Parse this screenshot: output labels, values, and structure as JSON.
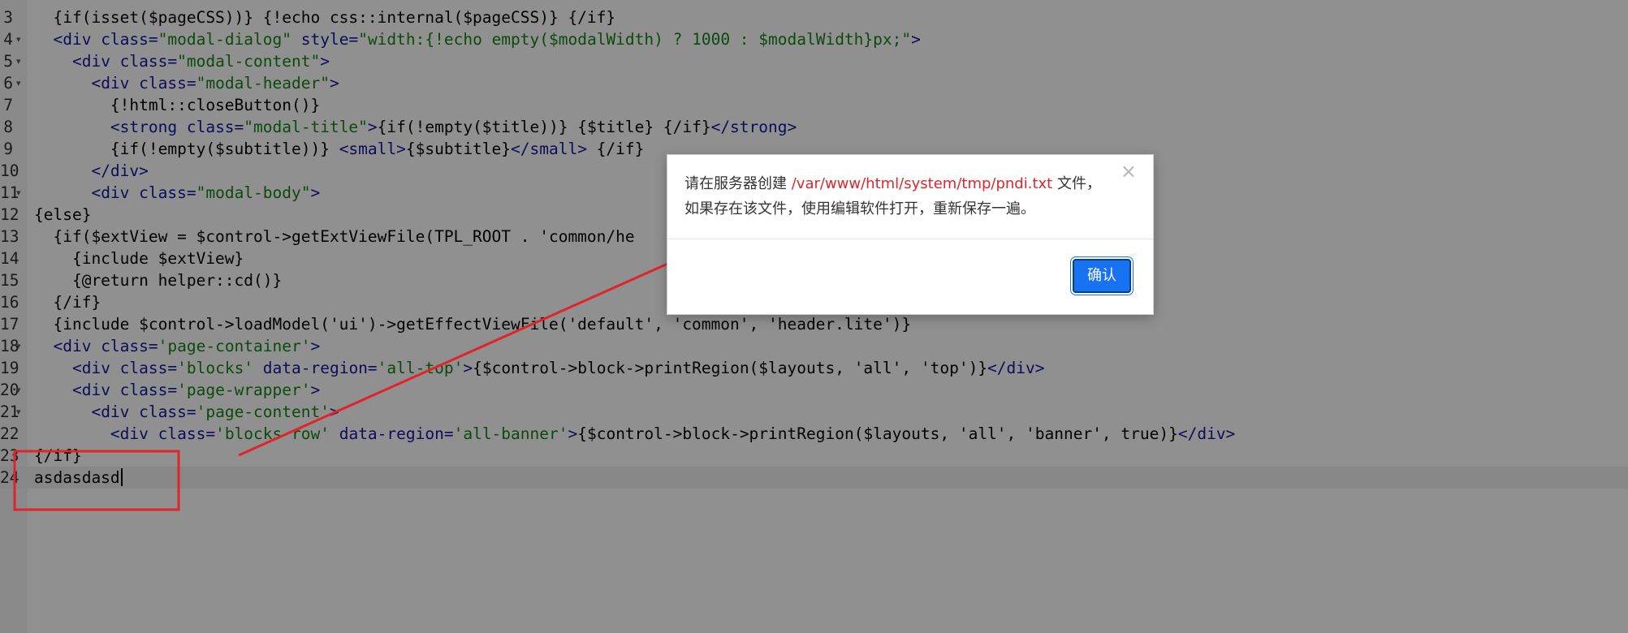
{
  "editor": {
    "lines": [
      {
        "num": "3",
        "fold": false,
        "active": false,
        "segments": [
          [
            "  {if(isset($pageCSS))} {!echo css::internal($pageCSS)} {/if}",
            "p"
          ]
        ]
      },
      {
        "num": "4",
        "fold": true,
        "active": false,
        "segments": [
          [
            "  ",
            "p"
          ],
          [
            "<div ",
            "t"
          ],
          [
            "class=",
            "t"
          ],
          [
            "\"modal-dialog\"",
            "s"
          ],
          [
            " style=",
            "t"
          ],
          [
            "\"width:{!echo empty($modalWidth) ? 1000 : $modalWidth}px;\"",
            "s"
          ],
          [
            ">",
            "t"
          ]
        ]
      },
      {
        "num": "5",
        "fold": true,
        "active": false,
        "segments": [
          [
            "    ",
            "p"
          ],
          [
            "<div ",
            "t"
          ],
          [
            "class=",
            "t"
          ],
          [
            "\"modal-content\"",
            "s"
          ],
          [
            ">",
            "t"
          ]
        ]
      },
      {
        "num": "6",
        "fold": true,
        "active": false,
        "segments": [
          [
            "      ",
            "p"
          ],
          [
            "<div ",
            "t"
          ],
          [
            "class=",
            "t"
          ],
          [
            "\"modal-header\"",
            "s"
          ],
          [
            ">",
            "t"
          ]
        ]
      },
      {
        "num": "7",
        "fold": false,
        "active": false,
        "segments": [
          [
            "        {!html::closeButton()}",
            "p"
          ]
        ]
      },
      {
        "num": "8",
        "fold": false,
        "active": false,
        "segments": [
          [
            "        ",
            "p"
          ],
          [
            "<strong ",
            "t"
          ],
          [
            "class=",
            "t"
          ],
          [
            "\"modal-title\"",
            "s"
          ],
          [
            ">",
            "t"
          ],
          [
            "{if(!empty($title))} {$title} {/if}",
            "p"
          ],
          [
            "</strong>",
            "t"
          ]
        ]
      },
      {
        "num": "9",
        "fold": false,
        "active": false,
        "segments": [
          [
            "        {if(!empty($subtitle))} ",
            "p"
          ],
          [
            "<small>",
            "t"
          ],
          [
            "{$subtitle}",
            "p"
          ],
          [
            "</small>",
            "t"
          ],
          [
            " {/if}",
            "p"
          ]
        ]
      },
      {
        "num": "10",
        "fold": false,
        "active": false,
        "segments": [
          [
            "      ",
            "p"
          ],
          [
            "</div>",
            "t"
          ]
        ]
      },
      {
        "num": "11",
        "fold": true,
        "active": false,
        "segments": [
          [
            "      ",
            "p"
          ],
          [
            "<div ",
            "t"
          ],
          [
            "class=",
            "t"
          ],
          [
            "\"modal-body\"",
            "s"
          ],
          [
            ">",
            "t"
          ]
        ]
      },
      {
        "num": "12",
        "fold": false,
        "active": false,
        "segments": [
          [
            "{else}",
            "p"
          ]
        ]
      },
      {
        "num": "13",
        "fold": false,
        "active": false,
        "segments": [
          [
            "  {if($extView = $control->getExtViewFile(TPL_ROOT . 'common/he",
            "p"
          ]
        ]
      },
      {
        "num": "14",
        "fold": false,
        "active": false,
        "segments": [
          [
            "    {include $extView}",
            "p"
          ]
        ]
      },
      {
        "num": "15",
        "fold": false,
        "active": false,
        "segments": [
          [
            "    {@return helper::cd()}",
            "p"
          ]
        ]
      },
      {
        "num": "16",
        "fold": false,
        "active": false,
        "segments": [
          [
            "  {/if}",
            "p"
          ]
        ]
      },
      {
        "num": "17",
        "fold": false,
        "active": false,
        "segments": [
          [
            "  {include $control->loadModel('ui')->getEffectViewFile('default', 'common', 'header.lite')}",
            "p"
          ]
        ]
      },
      {
        "num": "18",
        "fold": true,
        "active": false,
        "segments": [
          [
            "  ",
            "p"
          ],
          [
            "<div ",
            "t"
          ],
          [
            "class=",
            "t"
          ],
          [
            "'page-container'",
            "s"
          ],
          [
            ">",
            "t"
          ]
        ]
      },
      {
        "num": "19",
        "fold": false,
        "active": false,
        "segments": [
          [
            "    ",
            "p"
          ],
          [
            "<div ",
            "t"
          ],
          [
            "class=",
            "t"
          ],
          [
            "'blocks'",
            "s"
          ],
          [
            " data-region=",
            "t"
          ],
          [
            "'all-top'",
            "s"
          ],
          [
            ">",
            "t"
          ],
          [
            "{$control->block->printRegion($layouts, 'all', 'top')}",
            "p"
          ],
          [
            "</div>",
            "t"
          ]
        ]
      },
      {
        "num": "20",
        "fold": true,
        "active": false,
        "segments": [
          [
            "    ",
            "p"
          ],
          [
            "<div ",
            "t"
          ],
          [
            "class=",
            "t"
          ],
          [
            "'page-wrapper'",
            "s"
          ],
          [
            ">",
            "t"
          ]
        ]
      },
      {
        "num": "21",
        "fold": true,
        "active": false,
        "segments": [
          [
            "      ",
            "p"
          ],
          [
            "<div ",
            "t"
          ],
          [
            "class=",
            "t"
          ],
          [
            "'page-content'",
            "s"
          ],
          [
            ">",
            "t"
          ]
        ]
      },
      {
        "num": "22",
        "fold": false,
        "active": false,
        "segments": [
          [
            "        ",
            "p"
          ],
          [
            "<div ",
            "t"
          ],
          [
            "class=",
            "t"
          ],
          [
            "'blocks row'",
            "s"
          ],
          [
            " data-region=",
            "t"
          ],
          [
            "'all-banner'",
            "s"
          ],
          [
            ">",
            "t"
          ],
          [
            "{$control->block->printRegion($layouts, 'all', 'banner', true)}",
            "p"
          ],
          [
            "</div>",
            "t"
          ]
        ]
      },
      {
        "num": "23",
        "fold": false,
        "active": false,
        "segments": [
          [
            "{/if}",
            "p"
          ]
        ]
      },
      {
        "num": "24",
        "fold": false,
        "active": true,
        "segments": [
          [
            "asdasdasd",
            "p"
          ]
        ]
      }
    ]
  },
  "modal": {
    "message_prefix": "请在服务器创建 ",
    "path": "/var/www/html/system/tmp/pndi.txt",
    "message_suffix": " 文件，如果存在该文件，使用编辑软件打开，重新保存一遍。",
    "close_label": "×",
    "confirm_label": "确认"
  },
  "colors": {
    "annotation_red": "#e0242a",
    "path_red": "#e0242a",
    "confirm_blue": "#1773f2",
    "tag_color": "#0c0c5a",
    "string_color": "#0c4a0c"
  }
}
